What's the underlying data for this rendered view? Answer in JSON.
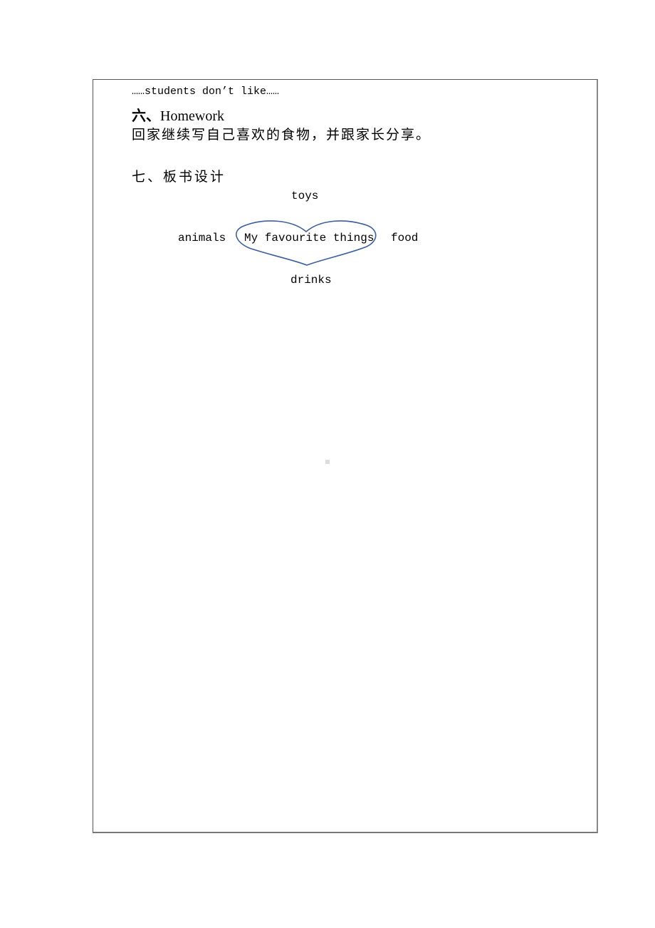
{
  "document": {
    "line_dislike": "……students don’t like……",
    "homework": {
      "number": "六、",
      "title": "Homework",
      "text": "回家继续写自己喜欢的食物，并跟家长分享。"
    },
    "board_design": {
      "heading": "七、板书设计",
      "center": "My favourite things",
      "top": "toys",
      "left": "animals",
      "right": "food",
      "bottom": "drinks",
      "heart_color": "#3b5fa0"
    }
  }
}
